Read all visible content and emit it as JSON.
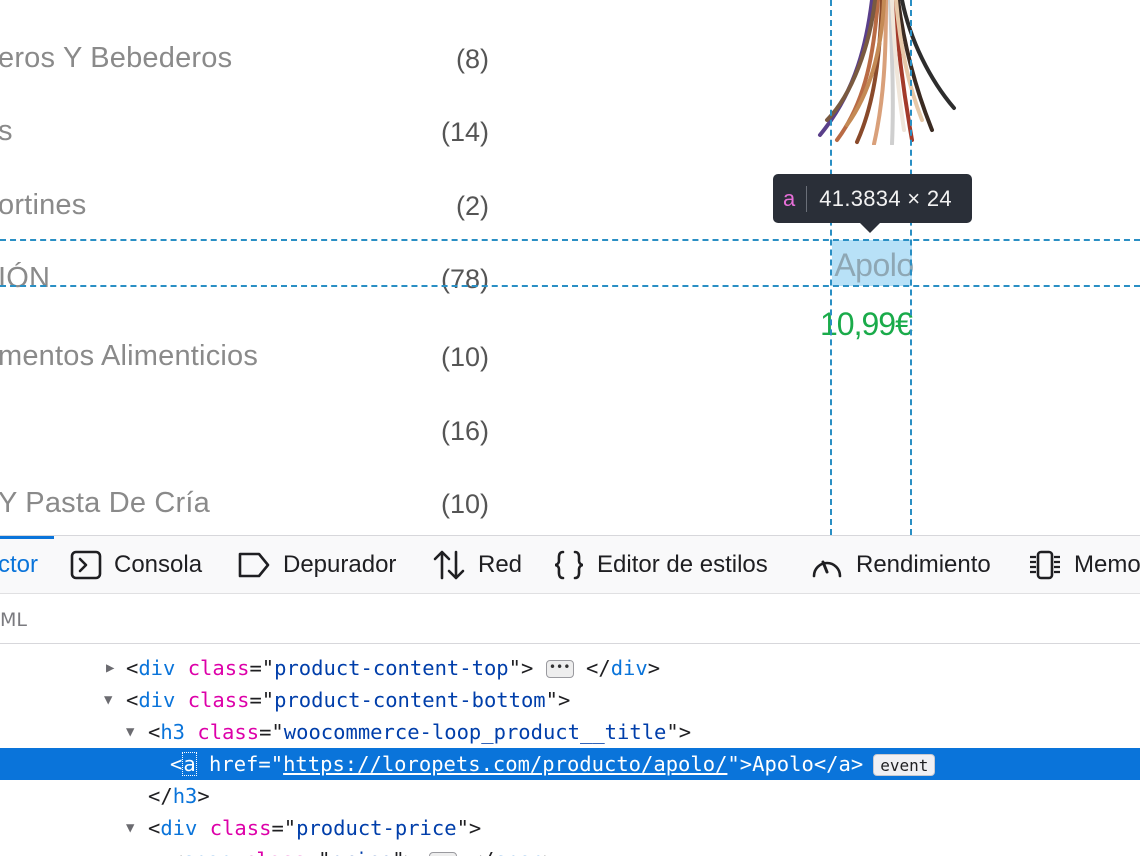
{
  "categories": [
    {
      "name": "eros Y Bebederos",
      "count": "(8)"
    },
    {
      "name": "s",
      "count": "(14)"
    },
    {
      "name": "ortines",
      "count": "(2)"
    },
    {
      "name": "IÓN",
      "count": "(78)"
    },
    {
      "name": "mentos Alimenticios",
      "count": "(10)"
    },
    {
      "name": "",
      "count": "(16)"
    },
    {
      "name": "Y Pasta De Cría",
      "count": "(10)"
    }
  ],
  "product": {
    "title": "Apolo",
    "price": "10,99€"
  },
  "tooltip": {
    "tag": "a",
    "dimensions": "41.3834 × 24"
  },
  "colors": {
    "highlight": "#0a74da",
    "price": "#1aab4a",
    "guide": "#2a8fc4"
  },
  "devtools": {
    "tabs": [
      {
        "label": "ctor",
        "icon": "inspector-icon"
      },
      {
        "label": "Consola",
        "icon": "console-icon"
      },
      {
        "label": "Depurador",
        "icon": "debugger-icon"
      },
      {
        "label": "Red",
        "icon": "network-icon"
      },
      {
        "label": "Editor de estilos",
        "icon": "style-editor-icon"
      },
      {
        "label": "Rendimiento",
        "icon": "performance-icon"
      },
      {
        "label": "Memo",
        "icon": "memory-icon"
      }
    ],
    "breadcrumb": "ML",
    "markup": {
      "line1": {
        "tag": "div",
        "attr": "class",
        "value": "product-content-top",
        "close": "div"
      },
      "line2": {
        "tag": "div",
        "attr": "class",
        "value": "product-content-bottom"
      },
      "line3": {
        "tag": "h3",
        "attr": "class",
        "value": "woocommerce-loop_product__title"
      },
      "line4": {
        "tag_open": "<",
        "tag": "a",
        "attr": "href",
        "value": "https://loropets.com/producto/apolo/",
        "text": "Apolo",
        "close": "a",
        "badge": "event"
      },
      "line5": {
        "close": "h3"
      },
      "line6": {
        "tag": "div",
        "attr": "class",
        "value": "product-price"
      },
      "line7": {
        "tag": "span",
        "attr": "class",
        "value": "price",
        "close": "span"
      }
    }
  }
}
